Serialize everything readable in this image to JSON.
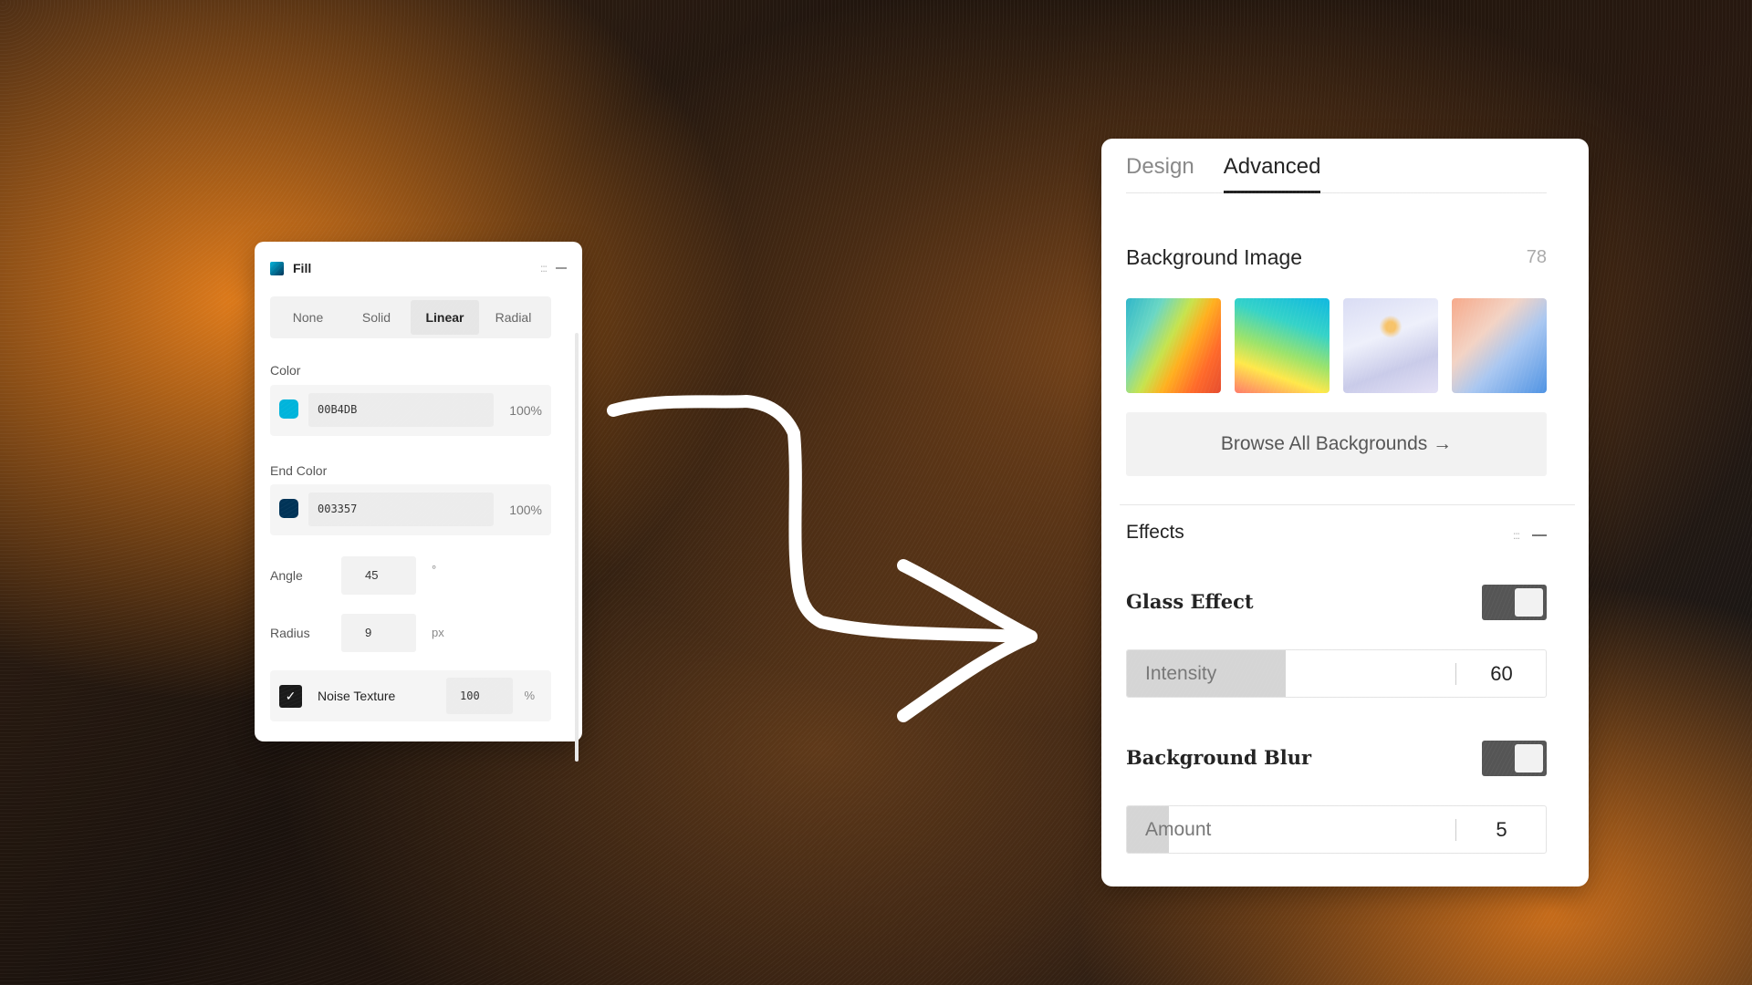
{
  "fill_panel": {
    "title": "Fill",
    "tabs": [
      {
        "label": "None"
      },
      {
        "label": "Solid"
      },
      {
        "label": "Linear",
        "active": true
      },
      {
        "label": "Radial"
      }
    ],
    "color": {
      "label": "Color",
      "hex": "00B4DB",
      "opacity": "100%",
      "swatch": "#00B4DB"
    },
    "end_color": {
      "label": "End Color",
      "hex": "003357",
      "opacity": "100%",
      "swatch": "#003357"
    },
    "angle": {
      "label": "Angle",
      "value": "45",
      "unit": "°"
    },
    "radius": {
      "label": "Radius",
      "value": "9",
      "unit": "px"
    },
    "noise": {
      "label": "Noise Texture",
      "checked": true,
      "value": "100",
      "unit": "%"
    }
  },
  "advanced_panel": {
    "tabs": [
      {
        "label": "Design"
      },
      {
        "label": "Advanced",
        "active": true
      }
    ],
    "background_image": {
      "title": "Background Image",
      "count": "78",
      "thumbnails": [
        "gradient-thumbnail-1",
        "gradient-thumbnail-2",
        "gradient-thumbnail-3",
        "gradient-thumbnail-4"
      ],
      "browse_label": "Browse All Backgrounds →"
    },
    "effects": {
      "title": "Effects",
      "glass": {
        "label": "Glass Effect",
        "enabled": true,
        "slider_label": "Intensity",
        "value": "60",
        "fill_fraction": 0.38
      },
      "blur": {
        "label": "Background Blur",
        "enabled": true,
        "slider_label": "Amount",
        "value": "5",
        "fill_fraction": 0.1
      }
    }
  },
  "colors": {
    "accent_cyan": "#00B4DB",
    "accent_navy": "#003357",
    "toggle_track": "#555555"
  }
}
